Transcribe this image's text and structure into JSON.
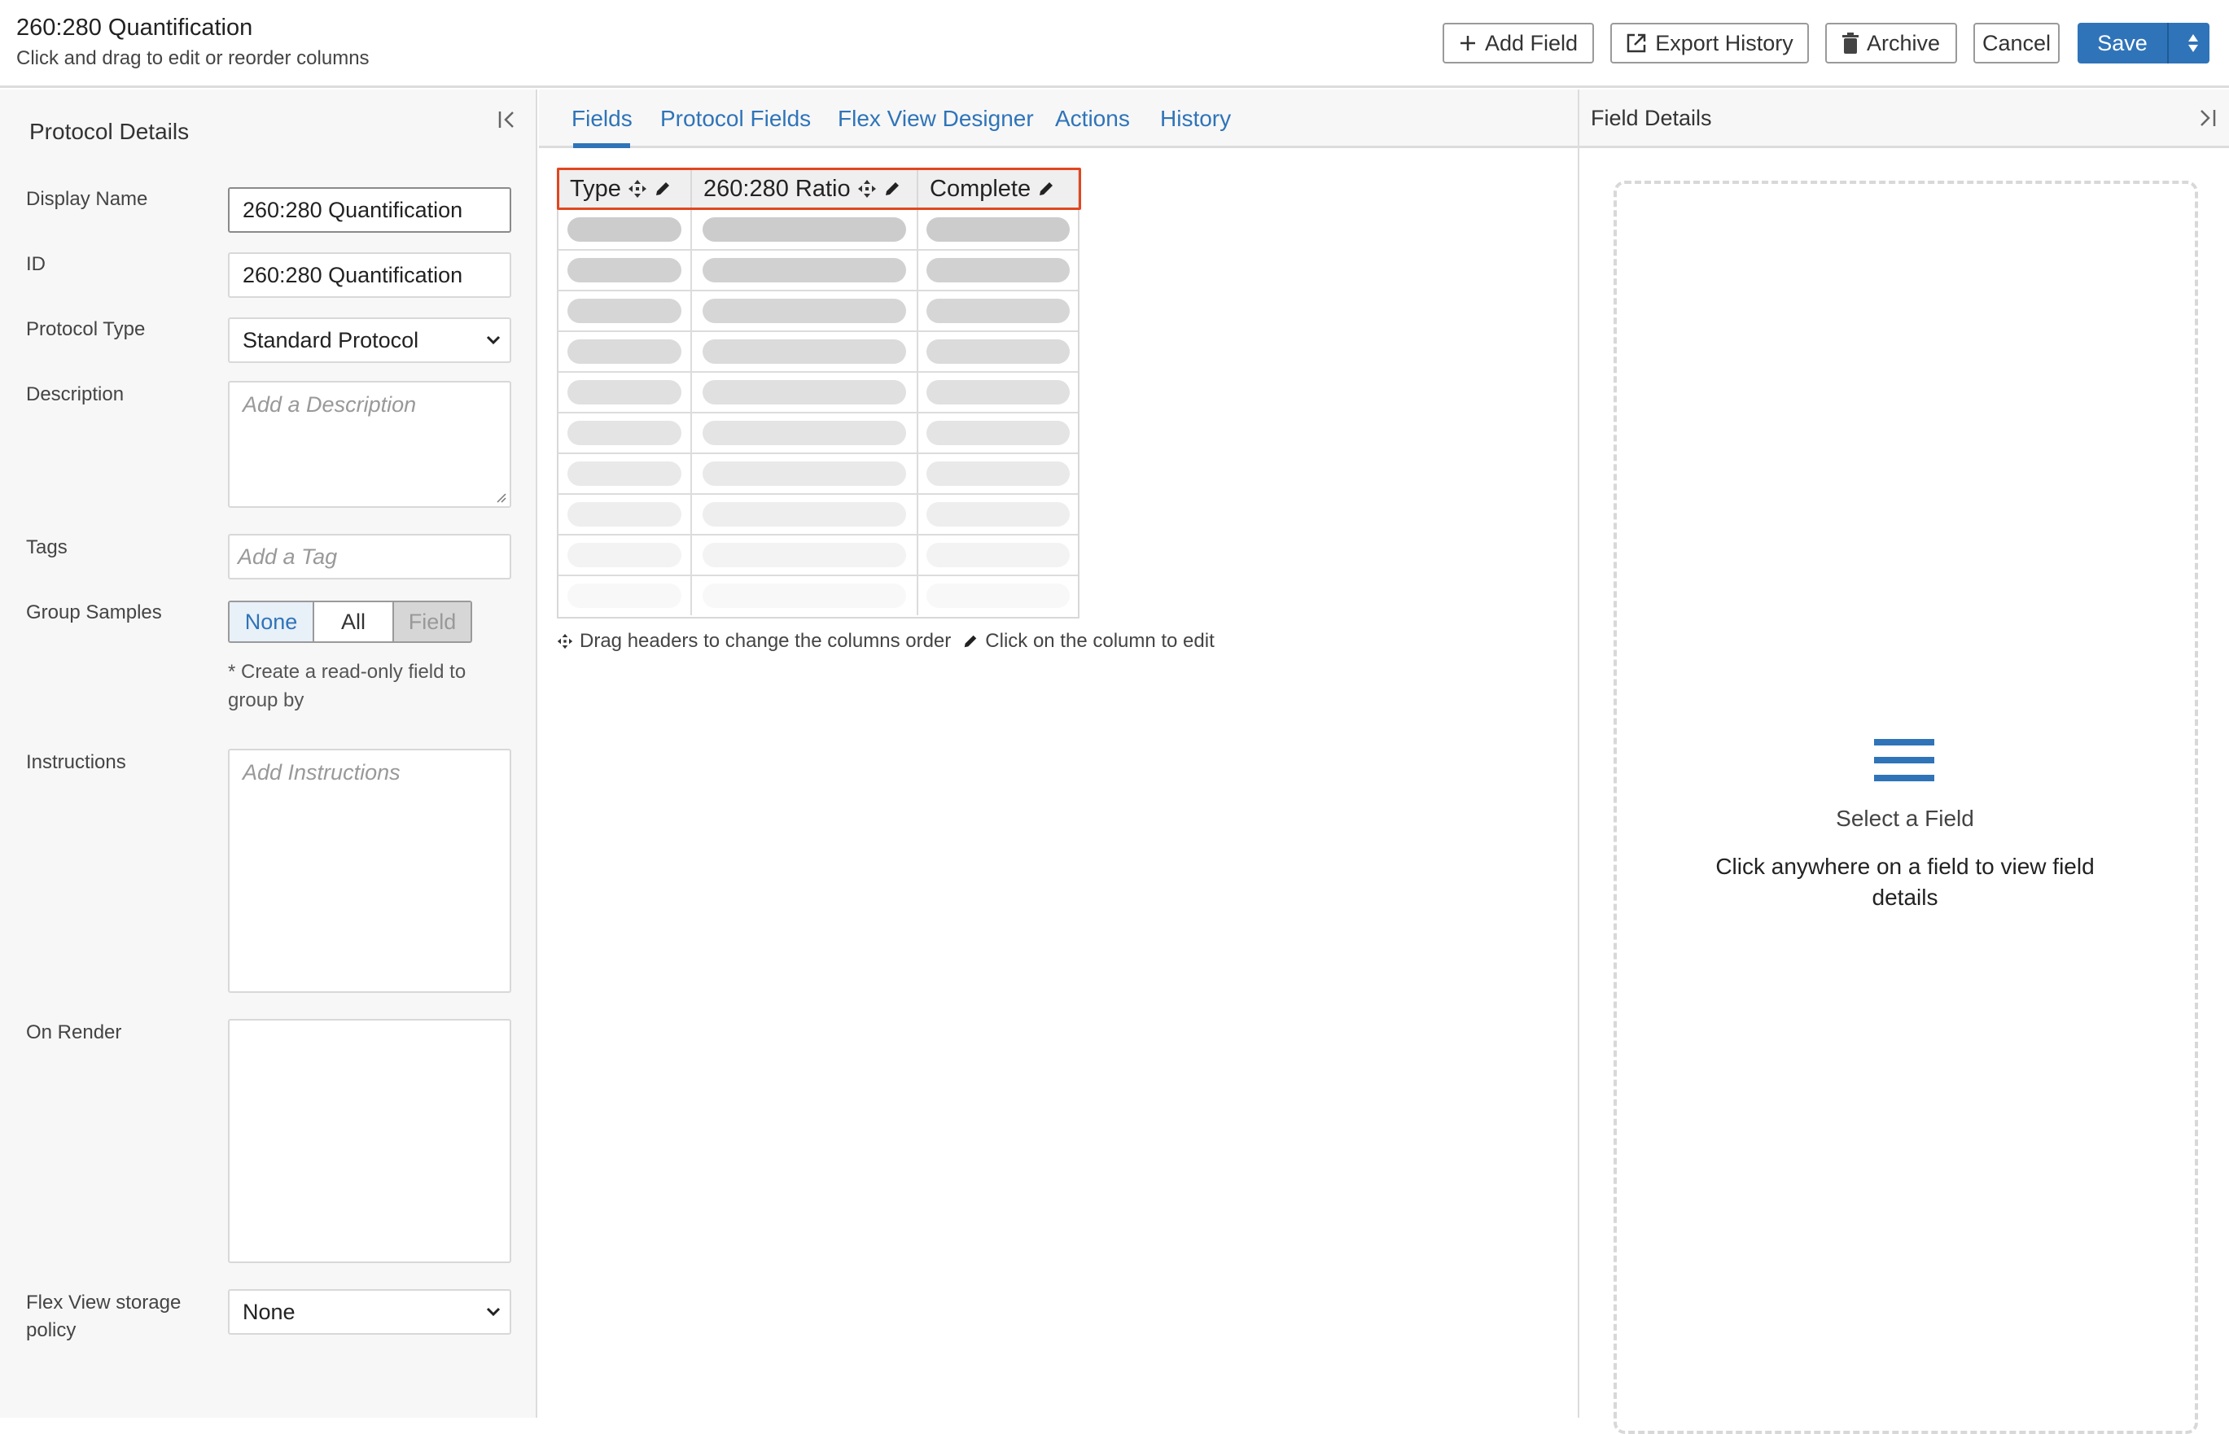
{
  "header": {
    "title": "260:280 Quantification",
    "subtitle": "Click and drag to edit or reorder columns",
    "buttons": {
      "add_field": "Add Field",
      "export_history": "Export History",
      "archive": "Archive",
      "cancel": "Cancel",
      "save": "Save"
    }
  },
  "left_panel": {
    "title": "Protocol Details",
    "fields": {
      "display_name": {
        "label": "Display Name",
        "value": "260:280 Quantification"
      },
      "id": {
        "label": "ID",
        "value": "260:280 Quantification"
      },
      "protocol_type": {
        "label": "Protocol Type",
        "value": "Standard Protocol"
      },
      "description": {
        "label": "Description",
        "placeholder": "Add a Description"
      },
      "tags": {
        "label": "Tags",
        "placeholder": "Add a Tag"
      },
      "group_samples": {
        "label": "Group Samples",
        "options": [
          "None",
          "All",
          "Field"
        ],
        "selected": "None",
        "note": "* Create a read-only field to group by"
      },
      "instructions": {
        "label": "Instructions",
        "placeholder": "Add Instructions"
      },
      "on_render": {
        "label": "On Render",
        "value": ""
      },
      "flex_view_storage_policy": {
        "label": "Flex View storage policy",
        "value": "None"
      }
    }
  },
  "center": {
    "tabs": [
      "Fields",
      "Protocol Fields",
      "Flex View Designer",
      "Actions",
      "History"
    ],
    "active_tab": "Fields",
    "columns": [
      "Type",
      "260:280 Ratio",
      "Complete"
    ],
    "placeholder_rows": 10,
    "hint_drag": "Drag headers to change the columns order",
    "hint_edit": "Click on the column to edit"
  },
  "right_panel": {
    "title": "Field Details",
    "empty_title": "Select a Field",
    "empty_text": "Click anywhere on a field to view field details"
  },
  "colors": {
    "accent": "#2f74b9",
    "highlight_outline": "#e2461f"
  }
}
